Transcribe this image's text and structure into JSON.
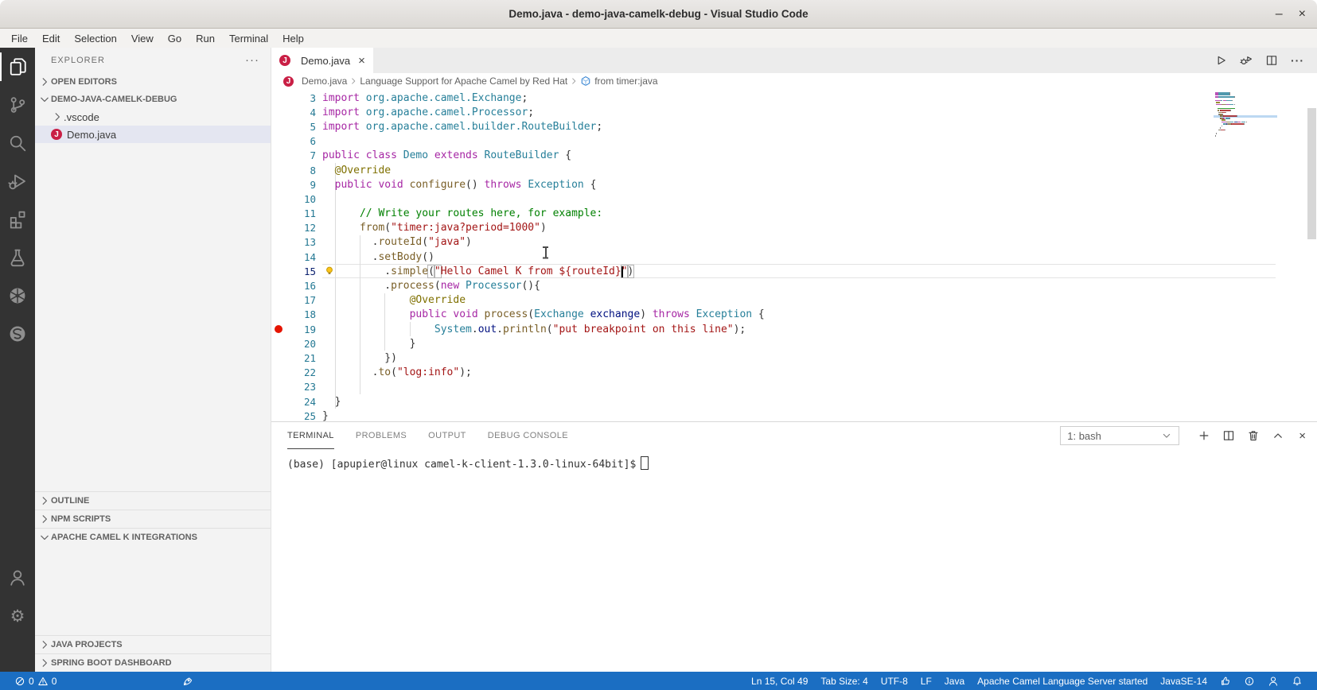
{
  "window": {
    "title": "Demo.java - demo-java-camelk-debug - Visual Studio Code",
    "controls": {
      "minimize": "–",
      "close": "×"
    }
  },
  "menu_bar": {
    "items": [
      "File",
      "Edit",
      "Selection",
      "View",
      "Go",
      "Run",
      "Terminal",
      "Help"
    ]
  },
  "activity_bar": {
    "top": [
      {
        "id": "explorer",
        "icon": "files-icon",
        "active": true
      },
      {
        "id": "source-control",
        "icon": "source-control-icon",
        "active": false
      },
      {
        "id": "search",
        "icon": "search-icon",
        "active": false
      },
      {
        "id": "run-debug",
        "icon": "debug-icon",
        "active": false
      },
      {
        "id": "extensions",
        "icon": "extensions-icon",
        "active": false
      },
      {
        "id": "test",
        "icon": "beaker-icon",
        "active": false
      },
      {
        "id": "kubernetes",
        "icon": "kubernetes-icon",
        "active": false
      },
      {
        "id": "spring",
        "icon": "spring-icon",
        "active": false
      }
    ],
    "bottom": [
      {
        "id": "accounts",
        "icon": "account-icon",
        "active": false
      },
      {
        "id": "settings",
        "icon": "gear-icon",
        "active": false
      }
    ]
  },
  "sidebar": {
    "title": "EXPLORER",
    "more_icon": "more-actions-icon",
    "rows": [
      {
        "label": "OPEN EDITORS",
        "kind": "hdr",
        "chevron": "right"
      },
      {
        "label": "DEMO-JAVA-CAMELK-DEBUG",
        "kind": "hdr",
        "chevron": "down"
      },
      {
        "label": ".vscode",
        "kind": "file",
        "chevron": "right"
      },
      {
        "label": "Demo.java",
        "kind": "file",
        "icon": "java-file-icon",
        "selected": true
      }
    ],
    "java_badge_letter": "J",
    "sections_mid": [
      {
        "label": "OUTLINE",
        "chevron": "right"
      },
      {
        "label": "NPM SCRIPTS",
        "chevron": "right"
      },
      {
        "label": "APACHE CAMEL K INTEGRATIONS",
        "chevron": "down"
      }
    ],
    "sections_bottom": [
      {
        "label": "JAVA PROJECTS",
        "chevron": "right"
      },
      {
        "label": "SPRING BOOT DASHBOARD",
        "chevron": "right"
      }
    ]
  },
  "editor": {
    "tabs": [
      {
        "label": "Demo.java",
        "icon": "java-file-icon",
        "active": true,
        "close_glyph": "×"
      }
    ],
    "actions": [
      "run-icon",
      "debug-run-icon",
      "split-editor-icon",
      "more-actions-icon"
    ],
    "breadcrumbs": [
      {
        "label": "Demo.java",
        "icon": "java-file-icon"
      },
      {
        "label": "Language Support for Apache Camel by Red Hat"
      },
      {
        "label": "from timer:java",
        "icon": "camel-k-icon"
      }
    ],
    "code": {
      "lines": [
        {
          "n": 3,
          "s": [
            [
              "kw",
              "import "
            ],
            [
              "typ",
              "org.apache.camel.Exchange"
            ],
            [
              "pln",
              ";"
            ]
          ]
        },
        {
          "n": 4,
          "s": [
            [
              "kw",
              "import "
            ],
            [
              "typ",
              "org.apache.camel.Processor"
            ],
            [
              "pln",
              ";"
            ]
          ]
        },
        {
          "n": 5,
          "s": [
            [
              "kw",
              "import "
            ],
            [
              "typ",
              "org.apache.camel.builder.RouteBuilder"
            ],
            [
              "pln",
              ";"
            ]
          ]
        },
        {
          "n": 6,
          "s": []
        },
        {
          "n": 7,
          "s": [
            [
              "kw",
              "public class "
            ],
            [
              "typ",
              "Demo"
            ],
            [
              "kw",
              " extends "
            ],
            [
              "typ",
              "RouteBuilder"
            ],
            [
              "pln",
              " {"
            ]
          ]
        },
        {
          "n": 8,
          "s": [
            [
              "pln",
              "  "
            ],
            [
              "ann",
              "@Override"
            ]
          ]
        },
        {
          "n": 9,
          "s": [
            [
              "pln",
              "  "
            ],
            [
              "kw",
              "public void "
            ],
            [
              "fn",
              "configure"
            ],
            [
              "pln",
              "() "
            ],
            [
              "kw",
              "throws"
            ],
            [
              "pln",
              " "
            ],
            [
              "typ",
              "Exception"
            ],
            [
              "pln",
              " {"
            ]
          ]
        },
        {
          "n": 10,
          "s": [],
          "g": 6
        },
        {
          "n": 11,
          "s": [
            [
              "cmt",
              "      // Write your routes here, for example:"
            ]
          ]
        },
        {
          "n": 12,
          "s": [
            [
              "pln",
              "      "
            ],
            [
              "fn",
              "from"
            ],
            [
              "pln",
              "("
            ],
            [
              "str",
              "\"timer:java?period=1000\""
            ],
            [
              "pln",
              ")"
            ]
          ]
        },
        {
          "n": 13,
          "s": [
            [
              "pln",
              "        ."
            ],
            [
              "fn",
              "routeId"
            ],
            [
              "pln",
              "("
            ],
            [
              "str",
              "\"java\""
            ],
            [
              "pln",
              ")"
            ]
          ]
        },
        {
          "n": 14,
          "s": [
            [
              "pln",
              "        ."
            ],
            [
              "fn",
              "setBody"
            ],
            [
              "pln",
              "()"
            ]
          ]
        },
        {
          "n": 15,
          "current": true,
          "lightbulb": true,
          "s": [
            [
              "pln",
              "          ."
            ],
            [
              "fn",
              "simple"
            ],
            [
              "pln b",
              "("
            ],
            [
              "str b",
              "\""
            ],
            [
              "str",
              "Hello Camel K from ${routeId}"
            ],
            [
              "caret",
              ""
            ],
            [
              "str b",
              "\""
            ],
            [
              "pln b",
              ")"
            ]
          ]
        },
        {
          "n": 16,
          "s": [
            [
              "pln",
              "          ."
            ],
            [
              "fn",
              "process"
            ],
            [
              "pln",
              "("
            ],
            [
              "kw",
              "new"
            ],
            [
              "pln",
              " "
            ],
            [
              "typ",
              "Processor"
            ],
            [
              "pln",
              "(){"
            ]
          ]
        },
        {
          "n": 17,
          "s": [
            [
              "pln",
              "              "
            ],
            [
              "ann",
              "@Override"
            ]
          ]
        },
        {
          "n": 18,
          "s": [
            [
              "pln",
              "              "
            ],
            [
              "kw",
              "public void "
            ],
            [
              "fn",
              "process"
            ],
            [
              "pln",
              "("
            ],
            [
              "typ",
              "Exchange"
            ],
            [
              "pln",
              " "
            ],
            [
              "var",
              "exchange"
            ],
            [
              "pln",
              ") "
            ],
            [
              "kw",
              "throws"
            ],
            [
              "pln",
              " "
            ],
            [
              "typ",
              "Exception"
            ],
            [
              "pln",
              " {"
            ]
          ]
        },
        {
          "n": 19,
          "breakpoint": true,
          "s": [
            [
              "pln",
              "                  "
            ],
            [
              "typ",
              "System"
            ],
            [
              "pln",
              "."
            ],
            [
              "var",
              "out"
            ],
            [
              "pln",
              "."
            ],
            [
              "fn",
              "println"
            ],
            [
              "pln",
              "("
            ],
            [
              "str",
              "\"put breakpoint on this line\""
            ],
            [
              "pln",
              ");"
            ]
          ]
        },
        {
          "n": 20,
          "s": [
            [
              "pln",
              "              }"
            ]
          ]
        },
        {
          "n": 21,
          "s": [
            [
              "pln",
              "          })"
            ]
          ]
        },
        {
          "n": 22,
          "s": [
            [
              "pln",
              "        ."
            ],
            [
              "fn",
              "to"
            ],
            [
              "pln",
              "("
            ],
            [
              "str",
              "\"log:info\""
            ],
            [
              "pln",
              ");"
            ]
          ]
        },
        {
          "n": 23,
          "s": [],
          "g": 8
        },
        {
          "n": 24,
          "s": [
            [
              "pln",
              "  }"
            ]
          ]
        },
        {
          "n": 25,
          "s": [
            [
              "pln",
              "}"
            ]
          ]
        }
      ]
    }
  },
  "panel": {
    "tabs": [
      {
        "label": "TERMINAL",
        "active": true
      },
      {
        "label": "PROBLEMS",
        "active": false
      },
      {
        "label": "OUTPUT",
        "active": false
      },
      {
        "label": "DEBUG CONSOLE",
        "active": false
      }
    ],
    "shell_select": {
      "value": "1: bash",
      "icon": "chevron-down-icon"
    },
    "actions": [
      "new-terminal-icon",
      "split-terminal-icon",
      "kill-terminal-icon",
      "maximize-panel-icon",
      "close-panel-icon"
    ],
    "terminal": {
      "prompt": "(base) [apupier@linux camel-k-client-1.3.0-linux-64bit]$"
    }
  },
  "status_bar": {
    "background": "#1b6ec2",
    "left": [
      {
        "id": "problems",
        "parts": [
          {
            "icon": "error-icon",
            "text": "0"
          },
          {
            "icon": "warning-icon",
            "text": "0"
          }
        ]
      },
      {
        "id": "java-server-mode",
        "icon": "rocket-icon"
      }
    ],
    "right": [
      {
        "id": "cursor-position",
        "text": "Ln 15, Col 49"
      },
      {
        "id": "indentation",
        "text": "Tab Size: 4"
      },
      {
        "id": "encoding",
        "text": "UTF-8"
      },
      {
        "id": "eol",
        "text": "LF"
      },
      {
        "id": "language-mode",
        "text": "Java"
      },
      {
        "id": "camel-ls-status",
        "text": "Apache Camel Language Server started"
      },
      {
        "id": "java-runtime",
        "text": "JavaSE-14"
      },
      {
        "id": "feedback",
        "icon": "feedback-icon"
      },
      {
        "id": "info",
        "icon": "info-icon"
      },
      {
        "id": "accounts",
        "icon": "person-icon"
      },
      {
        "id": "notifications",
        "icon": "bell-icon"
      }
    ]
  },
  "colors": {
    "status_bar": "#1b6ec2",
    "activity_bar": "#333333",
    "sidebar": "#f3f3f3",
    "selection_row": "#e4e6f1",
    "breakpoint": "#e51400",
    "java_badge": "#c91f45",
    "keyword": "#a626a4",
    "type": "#267f99",
    "function": "#795e26",
    "string": "#a31515",
    "comment": "#008000"
  }
}
